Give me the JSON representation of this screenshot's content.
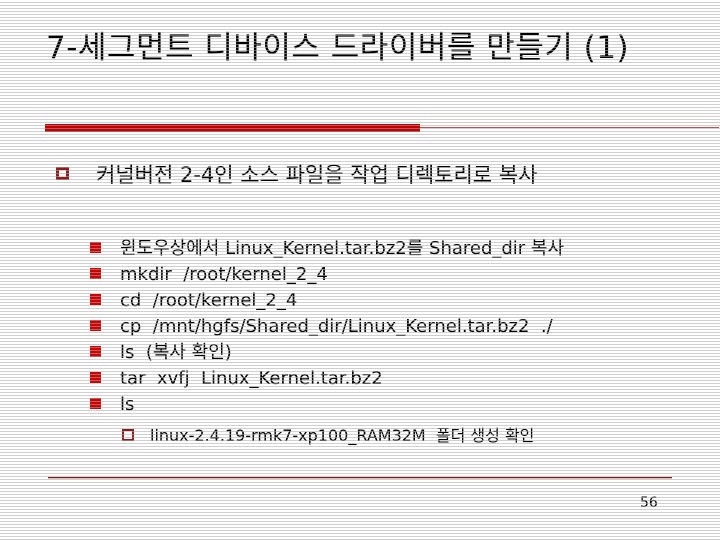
{
  "slide": {
    "title": "7-세그먼트 디바이스 드라이버를 만들기 (1)",
    "page_number": "56",
    "colors": {
      "title_bar_thick": "#C00000",
      "title_bar_thin": "#C0504D",
      "bullet_level1_marker": "#8E1B1B",
      "bullet_level2_marker": "#CC0000",
      "bullet_level3_marker": "#8E1B1B",
      "footer_line_dark": "#7C1D1D",
      "footer_line_light": "#E6B9B8",
      "text": "#000000",
      "background": "#FFFFFF"
    }
  },
  "content": {
    "level1": [
      {
        "marker": "hollow-square-bullet",
        "text": "커널버전 2-4인 소스 파일을 작업 디렉토리로 복사"
      }
    ],
    "level2": [
      {
        "marker": "filled-square-bullet",
        "text": "윈도우상에서 Linux_Kernel.tar.bz2를 Shared_dir 복사"
      },
      {
        "marker": "filled-square-bullet",
        "text": "mkdir  /root/kernel_2_4"
      },
      {
        "marker": "filled-square-bullet",
        "text": "cd  /root/kernel_2_4"
      },
      {
        "marker": "filled-square-bullet",
        "text": "cp  /mnt/hgfs/Shared_dir/Linux_Kernel.tar.bz2  ./"
      },
      {
        "marker": "filled-square-bullet",
        "text": "ls  (복사 확인)"
      },
      {
        "marker": "filled-square-bullet",
        "text": "tar  xvfj  Linux_Kernel.tar.bz2"
      },
      {
        "marker": "filled-square-bullet",
        "text": "ls"
      }
    ],
    "level3": [
      {
        "marker": "hollow-square-bullet",
        "text": "linux-2.4.19-rmk7-xp100_RAM32M  폴더 생성 확인"
      }
    ]
  }
}
